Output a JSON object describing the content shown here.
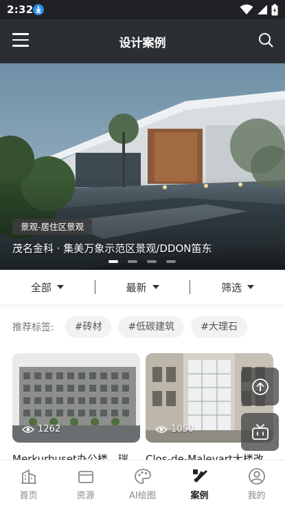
{
  "status_bar": {
    "time": "2:32"
  },
  "header": {
    "title": "设计案例"
  },
  "banner": {
    "tag": "景观-居住区景观",
    "caption": "茂名金科 · 集美万象示范区景观/DDON笛东",
    "active_dot": 0,
    "dot_count": 4
  },
  "filters": [
    {
      "label": "全部"
    },
    {
      "label": "最新"
    },
    {
      "label": "筛选"
    }
  ],
  "recommend": {
    "label": "推荐标签:",
    "tags": [
      "#砖材",
      "#低碳建筑",
      "#大理石"
    ]
  },
  "cards": [
    {
      "views": "1262",
      "title": "Merkurhuset办公楼，瑞"
    },
    {
      "views": "1050",
      "title": "Clos-de-Malevart大楼改"
    }
  ],
  "bottom_nav": {
    "active": "案例",
    "items": [
      {
        "label": "首页",
        "icon": "home-building-icon"
      },
      {
        "label": "资源",
        "icon": "folder-icon"
      },
      {
        "label": "AI绘图",
        "icon": "palette-icon"
      },
      {
        "label": "案例",
        "icon": "drafting-tools-icon"
      },
      {
        "label": "我的",
        "icon": "user-icon"
      }
    ]
  },
  "colors": {
    "status_bar": "#1f2124",
    "header": "#2b2f34",
    "chip_bg": "#f2f2f2",
    "fab_bg": "#464646",
    "active_nav": "#222222",
    "inactive_nav": "#888888"
  }
}
